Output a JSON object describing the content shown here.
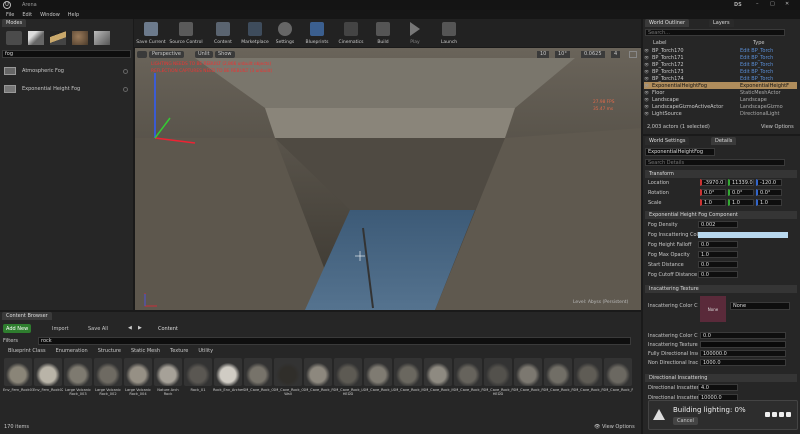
{
  "window": {
    "title": "Arena",
    "user": "DS"
  },
  "menu": [
    "File",
    "Edit",
    "Window",
    "Help"
  ],
  "modes": {
    "tab": "Modes",
    "search": "fog",
    "results": [
      "Atmospheric Fog",
      "Exponential Height Fog"
    ]
  },
  "toolbar": [
    "Save Current",
    "Source Control",
    "Content",
    "Marketplace",
    "Settings",
    "Blueprints",
    "Cinematics",
    "Build",
    "Play",
    "Launch"
  ],
  "viewport": {
    "perspective": "Perspective",
    "unlit": "Unlit",
    "show": "Show",
    "warn1": "LIGHTING NEEDS TO BE REBUILT (2,866 unbuilt objects)",
    "warn2": "REFLECTION CAPTURES NEED TO BE REBUILT (3 unbuilt)",
    "fps": "27.98 FPS",
    "ms": "35.47 ms",
    "level": "Level:  Abyss (Persistent)",
    "grid": "10",
    "angle": "10°",
    "scale": "0.0625",
    "cam": "4"
  },
  "content": {
    "tab": "Content Browser",
    "add": "Add New",
    "import": "Import",
    "save": "Save All",
    "path": "Content",
    "filters": "Filters",
    "search": "rock",
    "filter_tags": [
      "Blueprint Class",
      "Enumeration",
      "Structure",
      "Static Mesh",
      "Texture",
      "Utility"
    ],
    "count": "170 items",
    "view": "View Options"
  },
  "assets": [
    "Env_Fern_Rock01",
    "Env_Fern_Rock02",
    "Large Volcanic Rock_003",
    "Large Volcanic Rock_002",
    "Large Volcanic Rock_004",
    "Nature Arch Rock",
    "Rock_01",
    "Rock_Env_Arches_Smoke",
    "SM_Cave_Rock_Coliseu",
    "SM_Cave_Rock_Curved Wall",
    "SM_Cave_Rock_Floor01",
    "SM_Cave_Rock_Large01 HEDD",
    "SM_Cave_Rock_Large02",
    "SM_Cave_Rock_Medium01",
    "SM_Cave_Rock_Medium02",
    "SM_Cave_Rock_Parts_Set",
    "SM_Cave_Rock_Pillar01 HEDD",
    "SM_Cave_Rock_Pillar02",
    "SM_Cave_Rock_Pillar_Broken",
    "SM_Cave_Rock_Pillar_Bottom",
    "SM_Cave_Rock_Pillar_Broken01"
  ],
  "outliner": {
    "tabs": [
      "World Outliner",
      "Layers"
    ],
    "search": "Search...",
    "cols": [
      "Label",
      "Type"
    ],
    "rows": [
      [
        "BP_Torch170",
        "Edit BP_Torch"
      ],
      [
        "BP_Torch171",
        "Edit BP_Torch"
      ],
      [
        "BP_Torch172",
        "Edit BP_Torch"
      ],
      [
        "BP_Torch173",
        "Edit BP_Torch"
      ],
      [
        "BP_Torch174",
        "Edit BP_Torch"
      ],
      [
        "ExponentialHeightFog",
        "ExponentialHeightF"
      ],
      [
        "Floor",
        "StaticMeshActor"
      ],
      [
        "Landscape",
        "Landscape"
      ],
      [
        "LandscapeGizmoActiveActor",
        "LandscapeGizmo"
      ],
      [
        "LightSource",
        "DirectionalLight"
      ]
    ],
    "count": "2,003 actors (1 selected)",
    "view": "View Options"
  },
  "details": {
    "tabs": [
      "World Settings",
      "Details"
    ],
    "name": "ExponentialHeightFog",
    "search": "Search Details",
    "transform": {
      "header": "Transform",
      "location": "Location",
      "rotation": "Rotation",
      "scale": "Scale",
      "loc": [
        "-3970.0",
        "11339.0",
        "-120.0"
      ],
      "rot": [
        "0.0°",
        "0.0°",
        "0.0°"
      ],
      "scl": [
        "1.0",
        "1.0",
        "1.0"
      ]
    },
    "fog": {
      "header": "Exponential Height Fog Component",
      "labels": [
        "Fog Density",
        "Fog Inscattering Color",
        "Fog Height Falloff",
        "Fog Max Opacity",
        "Start Distance",
        "Fog Cutoff Distance"
      ],
      "values": [
        "0.002",
        "",
        "0.0",
        "1.0",
        "0.0",
        "0.0"
      ]
    },
    "tex": {
      "header": "Inscattering Texture",
      "labels": [
        "Inscattering Color Cub",
        "Inscattering Color Cub",
        "Inscattering Texture T",
        "Fully Directional Insca",
        "Non Directional Inscat"
      ],
      "none": "None",
      "values": [
        "",
        "0.0",
        "",
        "100000.0",
        "1000.0"
      ]
    },
    "dir": {
      "header": "Directional Inscattering",
      "labels": [
        "Directional Inscatterin",
        "Directional Inscatterin"
      ],
      "values": [
        "4.0",
        "10000.0"
      ]
    }
  },
  "build": {
    "text": "Building lighting:  0%",
    "cancel": "Cancel"
  }
}
